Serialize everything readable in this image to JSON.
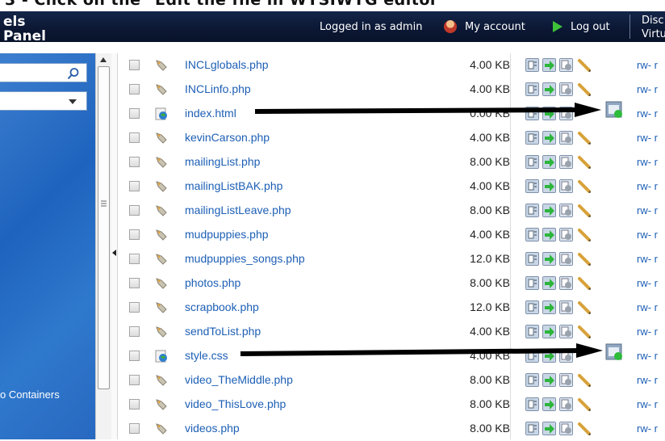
{
  "caption": "3 - Click on the \"Edit the file in WYSIWYG editor\"",
  "header": {
    "brand_line1": "els",
    "brand_line2": "Panel",
    "logged_in": "Logged in as admin",
    "my_account": "My account",
    "log_out": "Log out",
    "right_line1": "Disc",
    "right_line2": "Virtu"
  },
  "sidebar": {
    "containers_label": "o Containers"
  },
  "files": [
    {
      "name": "INCLglobals.php",
      "size": "4.00 KB",
      "perm": "rw- r",
      "type": "php"
    },
    {
      "name": "INCLinfo.php",
      "size": "4.00 KB",
      "perm": "rw- r",
      "type": "php"
    },
    {
      "name": "index.html",
      "size": "0.00 KB",
      "perm": "rw- r",
      "type": "html"
    },
    {
      "name": "kevinCarson.php",
      "size": "4.00 KB",
      "perm": "rw- r",
      "type": "php"
    },
    {
      "name": "mailingList.php",
      "size": "8.00 KB",
      "perm": "rw- r",
      "type": "php"
    },
    {
      "name": "mailingListBAK.php",
      "size": "4.00 KB",
      "perm": "rw- r",
      "type": "php"
    },
    {
      "name": "mailingListLeave.php",
      "size": "8.00 KB",
      "perm": "rw- r",
      "type": "php"
    },
    {
      "name": "mudpuppies.php",
      "size": "4.00 KB",
      "perm": "rw- r",
      "type": "php"
    },
    {
      "name": "mudpuppies_songs.php",
      "size": "12.0 KB",
      "perm": "rw- r",
      "type": "php"
    },
    {
      "name": "photos.php",
      "size": "8.00 KB",
      "perm": "rw- r",
      "type": "php"
    },
    {
      "name": "scrapbook.php",
      "size": "12.0 KB",
      "perm": "rw- r",
      "type": "php"
    },
    {
      "name": "sendToList.php",
      "size": "4.00 KB",
      "perm": "rw- r",
      "type": "php"
    },
    {
      "name": "style.css",
      "size": "4.00 KB",
      "perm": "rw- r",
      "type": "css"
    },
    {
      "name": "video_TheMiddle.php",
      "size": "8.00 KB",
      "perm": "rw- r",
      "type": "php"
    },
    {
      "name": "video_ThisLove.php",
      "size": "8.00 KB",
      "perm": "rw- r",
      "type": "php"
    },
    {
      "name": "videos.php",
      "size": "8.00 KB",
      "perm": "rw- r",
      "type": "php"
    }
  ],
  "colors": {
    "link": "#1d5fb5",
    "topbar": "#0b1733",
    "sidebar": "#2a6dc4"
  }
}
